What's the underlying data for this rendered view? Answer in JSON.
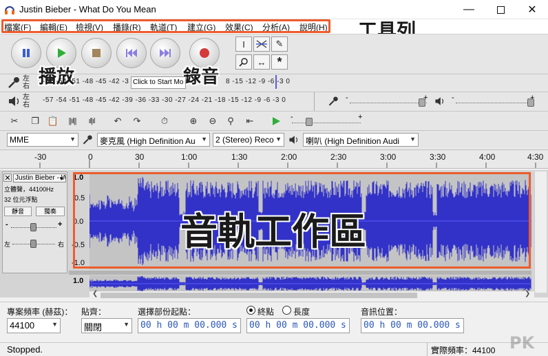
{
  "window": {
    "title": "Justin Bieber - What Do You Mean"
  },
  "menu": {
    "items": [
      "檔案(F)",
      "編輯(E)",
      "檢視(V)",
      "播錄(R)",
      "軌道(T)",
      "建立(G)",
      "效果(C)",
      "分析(A)",
      "說明(H)"
    ]
  },
  "annotations": {
    "toolbar": "工具列",
    "playback": "播放",
    "record": "錄音",
    "track_area": "音軌工作區"
  },
  "meters": {
    "lr_label": [
      "左",
      "右"
    ],
    "record_ticks": "-57 -54 -51 -48 -45 -42 -3",
    "record_click_text": "Click to Start Mo",
    "record_ticks_right": "8 -15 -12 -9 -6 -3 0",
    "play_ticks": "-57 -54 -51 -48 -45 -42 -39 -36 -33 -30 -27 -24 -21 -18 -15 -12 -9 -6 -3 0",
    "rec_slider_minus": "-",
    "rec_slider_plus": "+",
    "play_slider_minus": "-",
    "play_slider_plus": "+",
    "speed_minus": "-",
    "speed_plus": "+"
  },
  "device": {
    "host": "MME",
    "mic": "麥克風 (High Definition Au",
    "channels": "2 (Stereo) Reco",
    "speaker": "喇叭 (High Definition Audi"
  },
  "ruler": {
    "labels": [
      "-30",
      "0",
      "30",
      "1:00",
      "1:30",
      "2:00",
      "2:30",
      "3:00",
      "3:30",
      "4:00",
      "4:30"
    ]
  },
  "track": {
    "name": "Justin Bieber - W",
    "info1": "立體聲，44100Hz",
    "info2": "32 位元浮點",
    "mute": "靜音",
    "solo": "獨奏",
    "scale": [
      "1.0",
      "0.5",
      "0.0",
      "-0.5",
      "-1.0"
    ],
    "scale2_top": "1.0",
    "volume_minus": "-",
    "volume_plus": "+",
    "pan_left": "左",
    "pan_right": "右",
    "waveform_color": "#3232c8",
    "waveform_bg": "#c4c4c4"
  },
  "selection": {
    "rate_label": "專案頻率 (赫茲)：",
    "rate_value": "44100",
    "snap_label": "貼齊：",
    "snap_value": "關閉",
    "start_label": "選擇部份起點：",
    "end_radio": "終點",
    "length_radio": "長度",
    "audio_pos_label": "音訊位置：",
    "time_value": "00 h 00 m 00.000 s"
  },
  "status": {
    "text": "Stopped.",
    "actual_rate": "實際頻率：44100"
  },
  "watermark": "PK"
}
